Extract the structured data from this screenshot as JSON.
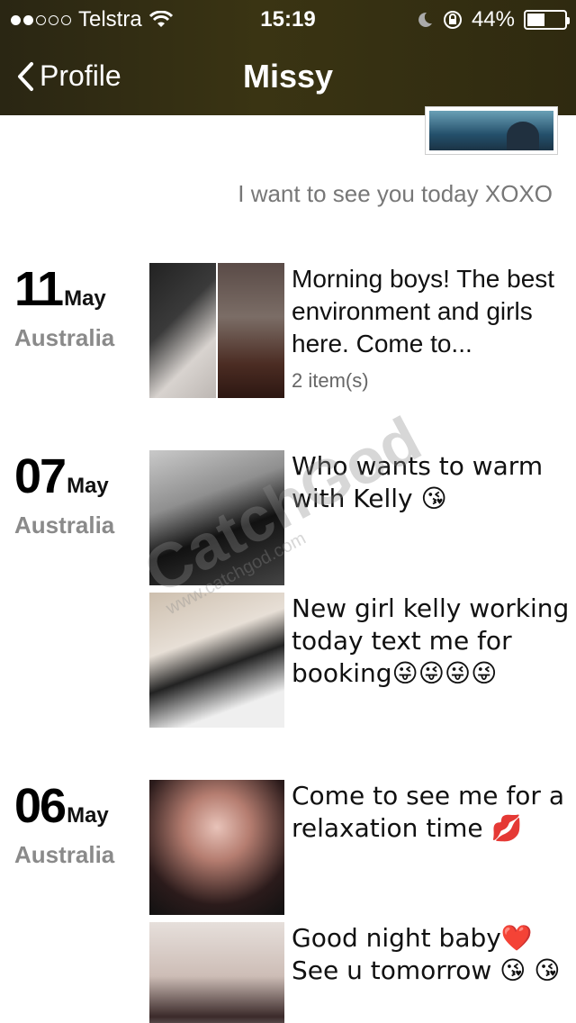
{
  "status_bar": {
    "carrier": "Telstra",
    "time": "15:19",
    "battery": "44%",
    "battery_level": 0.44
  },
  "nav": {
    "back_label": "Profile",
    "title": "Missy"
  },
  "top_caption": "I want to see you today XOXO",
  "watermark": {
    "text": "CatchGod",
    "sub": "www.catchgod.com"
  },
  "days": [
    {
      "day": "11",
      "month": "May",
      "location": "Australia",
      "posts": [
        {
          "text": "Morning boys! The best environment and girls here. Come to...",
          "count": "2 item(s)"
        }
      ]
    },
    {
      "day": "07",
      "month": "May",
      "location": "Australia",
      "posts": [
        {
          "text": "Who wants to warm with Kelly 😘"
        },
        {
          "text": "New girl kelly working today text me for booking😜😜😜😜"
        }
      ]
    },
    {
      "day": "06",
      "month": "May",
      "location": "Australia",
      "posts": [
        {
          "text": "Come to see me for a relaxation time 💋"
        },
        {
          "text": "Good night baby❤️ See u tomorrow 😘 😘"
        }
      ]
    }
  ]
}
